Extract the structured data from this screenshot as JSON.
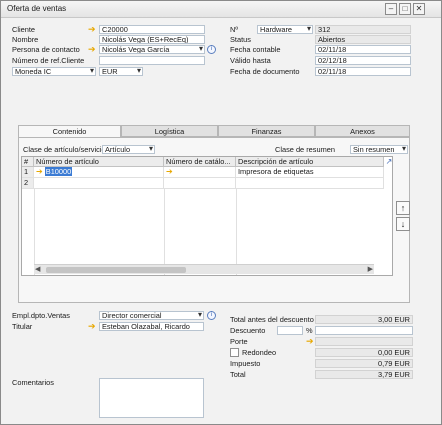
{
  "window": {
    "title": "Oferta de ventas"
  },
  "header_left": {
    "cliente": {
      "label": "Cliente",
      "value": "C20000"
    },
    "nombre": {
      "label": "Nombre",
      "value": "Nicolás Vega (ES+RecEq)"
    },
    "persona": {
      "label": "Persona de contacto",
      "value": "Nicolás Vega García"
    },
    "ref_cliente": {
      "label": "Número de ref.Cliente",
      "value": ""
    },
    "moneda": {
      "label": "Moneda IC",
      "value": "EUR"
    }
  },
  "header_right": {
    "numero": {
      "label": "Nº",
      "series": "Hardware",
      "value": "312"
    },
    "status": {
      "label": "Status",
      "value": "Abiertos"
    },
    "fecha_contable": {
      "label": "Fecha contable",
      "value": "02/11/18"
    },
    "valido_hasta": {
      "label": "Válido hasta",
      "value": "02/12/18"
    },
    "fecha_documento": {
      "label": "Fecha de documento",
      "value": "02/11/18"
    }
  },
  "tabs": [
    "Contenido",
    "Logística",
    "Finanzas",
    "Anexos"
  ],
  "content": {
    "clase_articulo_label": "Clase de artículo/servicio",
    "clase_articulo_value": "Artículo",
    "clase_resumen_label": "Clase de resumen",
    "clase_resumen_value": "Sin resumen"
  },
  "grid": {
    "columns": [
      "#",
      "Número de artículo",
      "Número de catálo...",
      "Descripción de artículo"
    ],
    "rows": [
      {
        "num": "1",
        "articulo": "B10000",
        "catalogo": "",
        "descripcion": "Impresora de etiquetas"
      },
      {
        "num": "2",
        "articulo": "",
        "catalogo": "",
        "descripcion": ""
      }
    ]
  },
  "footer_left": {
    "empl": {
      "label": "Empl.dpto.Ventas",
      "value": "Director comercial"
    },
    "titular": {
      "label": "Titular",
      "value": "Esteban Olazabal, Ricardo"
    },
    "comentarios": {
      "label": "Comentarios",
      "value": ""
    }
  },
  "totals": {
    "total_antes": {
      "label": "Total antes del descuento",
      "value": "3,00 EUR"
    },
    "descuento": {
      "label": "Descuento",
      "pct_symbol": "%",
      "value": ""
    },
    "porte": {
      "label": "Porte",
      "value": ""
    },
    "redondeo": {
      "label": "Redondeo",
      "value": "0,00 EUR"
    },
    "impuesto": {
      "label": "Impuesto",
      "value": "0,79 EUR"
    },
    "total": {
      "label": "Total",
      "value": "3,79 EUR"
    }
  },
  "colors": {
    "link_arrow": "#e8a800",
    "tab_active": "#f7f7f7",
    "field_border": "#b8c4d0"
  }
}
